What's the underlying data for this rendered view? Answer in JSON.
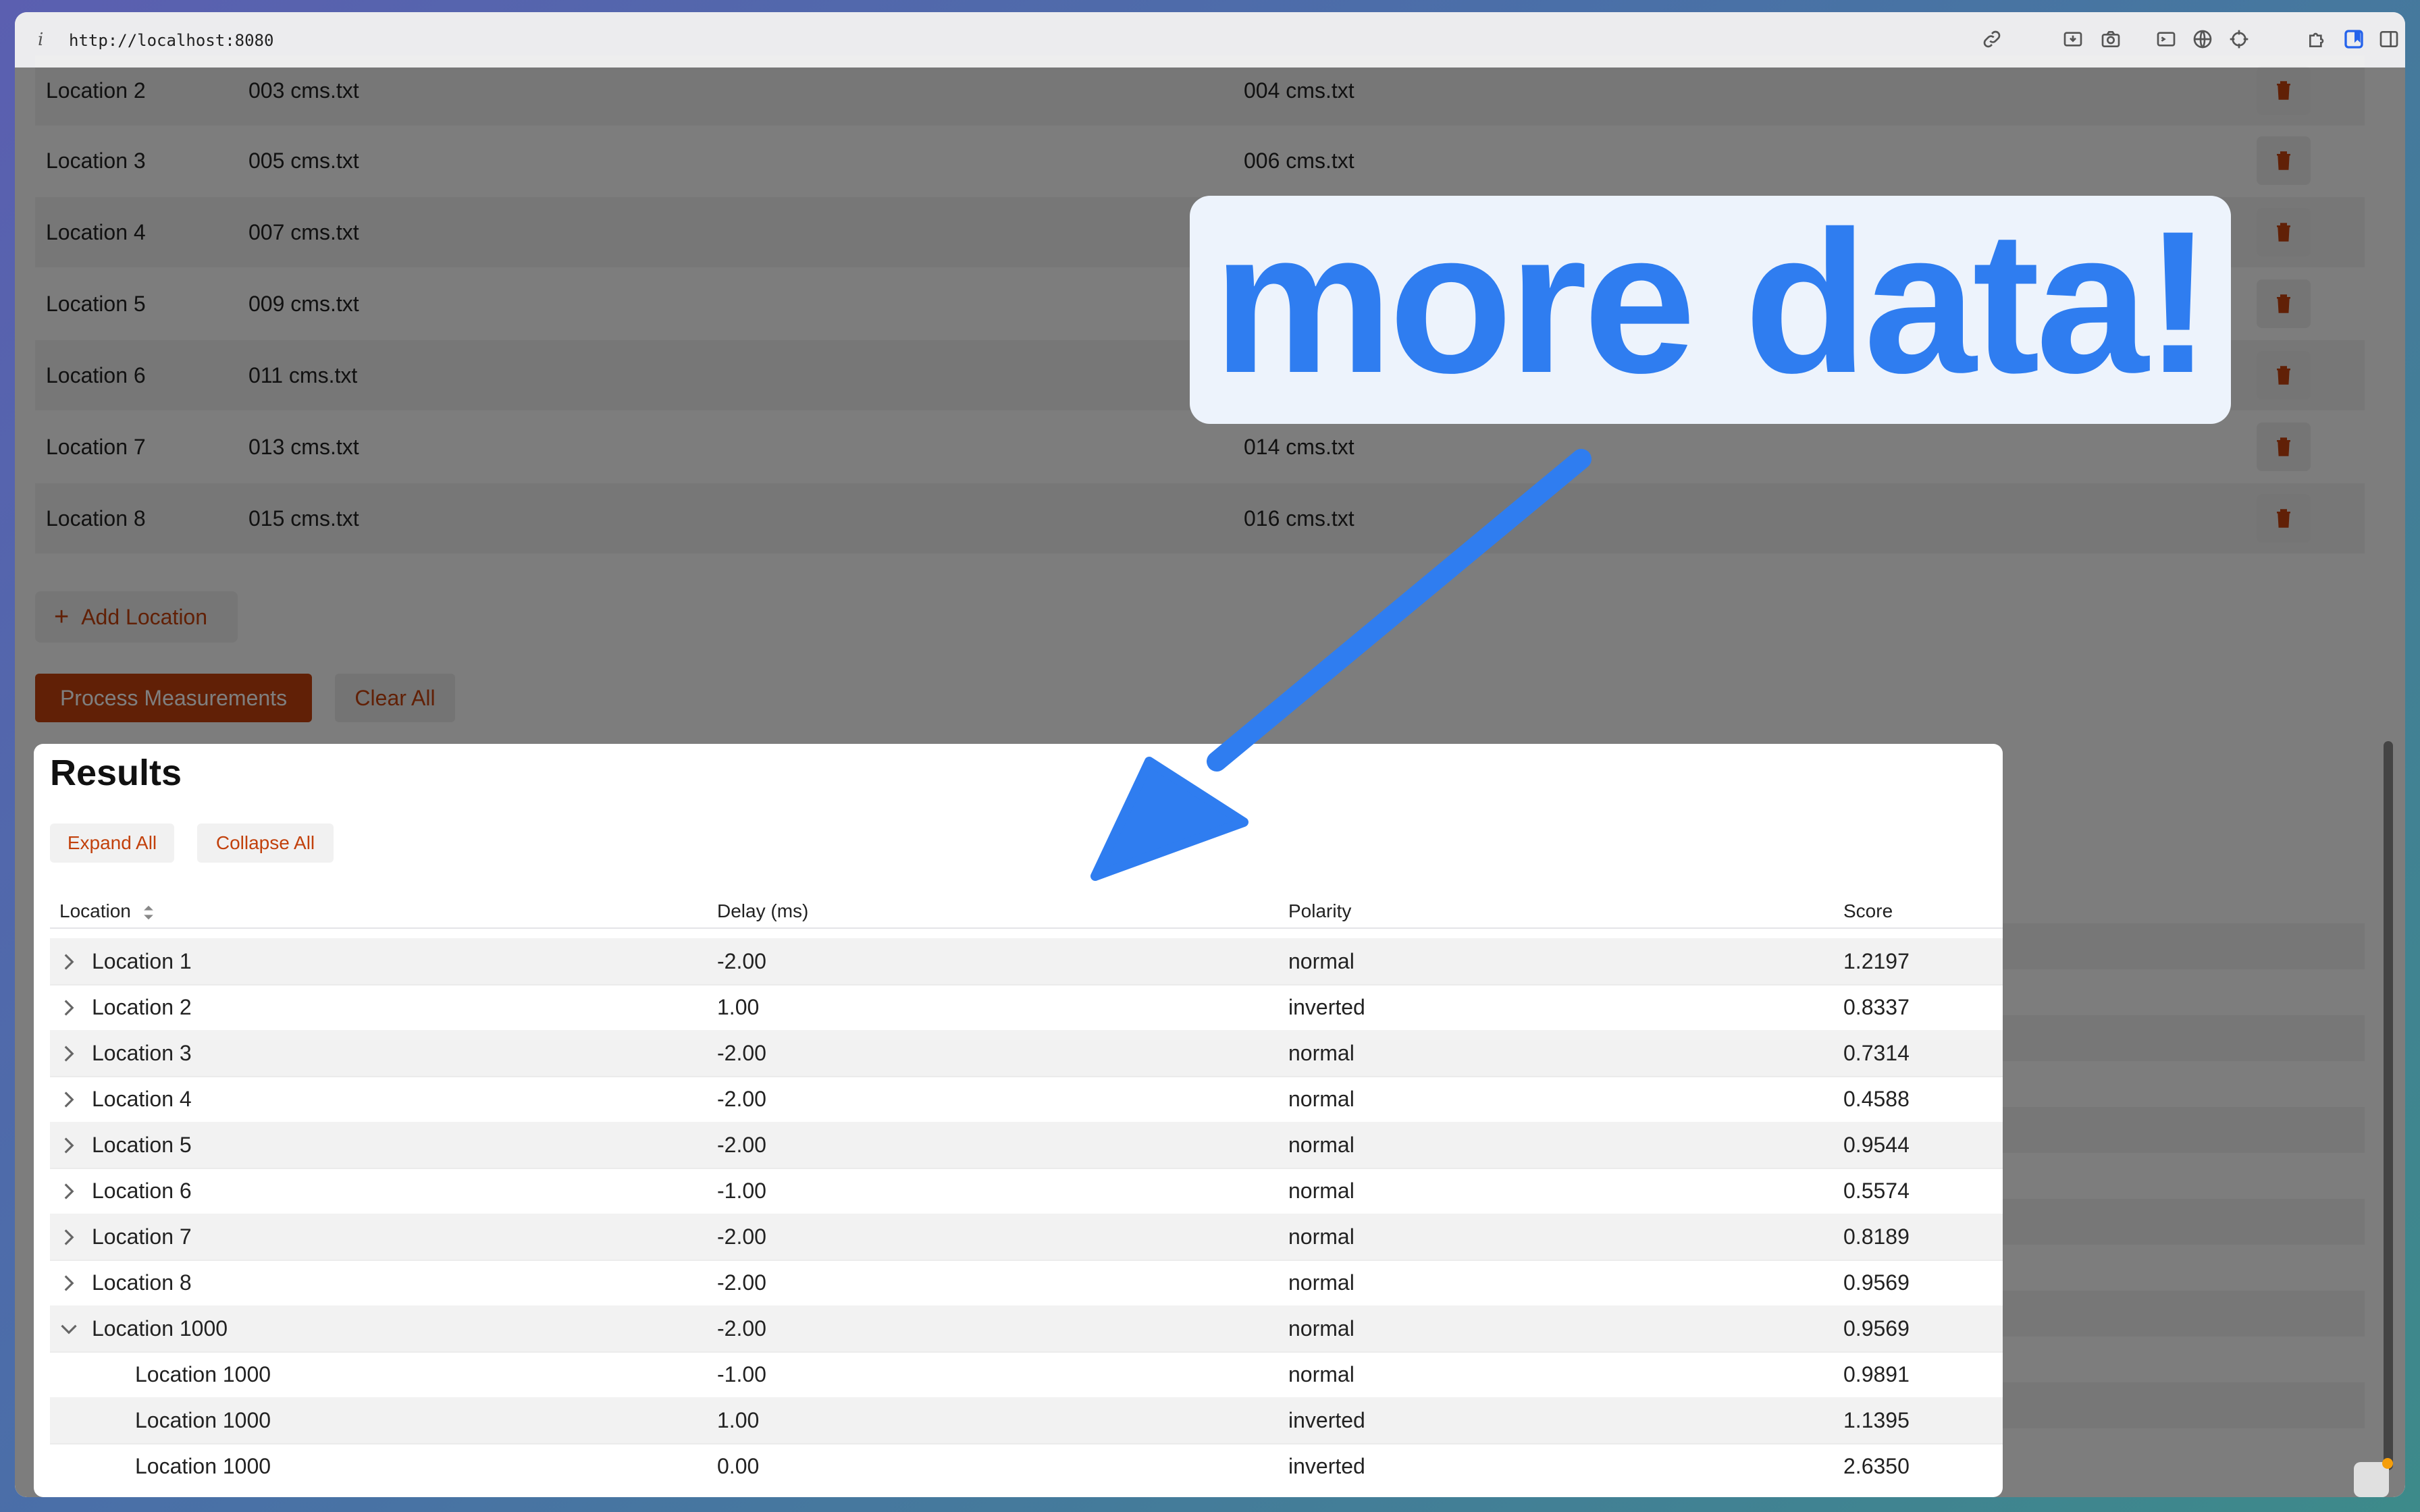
{
  "browser": {
    "url": "http://localhost:8080",
    "info_glyph": "i",
    "icons": [
      "link-icon",
      "download-icon",
      "camera-icon",
      "terminal-icon",
      "globe-icon",
      "crosshair-icon",
      "puzzle-icon",
      "bookmark-icon",
      "sidebar-icon"
    ]
  },
  "locations": [
    {
      "name": "Location 2",
      "file_a": "003 cms.txt",
      "file_b": "004 cms.txt"
    },
    {
      "name": "Location 3",
      "file_a": "005 cms.txt",
      "file_b": "006 cms.txt"
    },
    {
      "name": "Location 4",
      "file_a": "007 cms.txt",
      "file_b": ""
    },
    {
      "name": "Location 5",
      "file_a": "009 cms.txt",
      "file_b": ""
    },
    {
      "name": "Location 6",
      "file_a": "011 cms.txt",
      "file_b": ""
    },
    {
      "name": "Location 7",
      "file_a": "013 cms.txt",
      "file_b": "014 cms.txt"
    },
    {
      "name": "Location 8",
      "file_a": "015 cms.txt",
      "file_b": "016 cms.txt"
    }
  ],
  "buttons": {
    "add_location": "Add Location",
    "add_icon": "+",
    "process": "Process Measurements",
    "clear_all": "Clear All"
  },
  "results": {
    "title": "Results",
    "expand_all": "Expand All",
    "collapse_all": "Collapse All",
    "columns": [
      "Location",
      "Delay (ms)",
      "Polarity",
      "Score"
    ],
    "rows": [
      {
        "location": "Location 1",
        "delay": "-2.00",
        "polarity": "normal",
        "score": "1.2197",
        "state": "collapsed"
      },
      {
        "location": "Location 2",
        "delay": "1.00",
        "polarity": "inverted",
        "score": "0.8337",
        "state": "collapsed"
      },
      {
        "location": "Location 3",
        "delay": "-2.00",
        "polarity": "normal",
        "score": "0.7314",
        "state": "collapsed"
      },
      {
        "location": "Location 4",
        "delay": "-2.00",
        "polarity": "normal",
        "score": "0.4588",
        "state": "collapsed"
      },
      {
        "location": "Location 5",
        "delay": "-2.00",
        "polarity": "normal",
        "score": "0.9544",
        "state": "collapsed"
      },
      {
        "location": "Location 6",
        "delay": "-1.00",
        "polarity": "normal",
        "score": "0.5574",
        "state": "collapsed"
      },
      {
        "location": "Location 7",
        "delay": "-2.00",
        "polarity": "normal",
        "score": "0.8189",
        "state": "collapsed"
      },
      {
        "location": "Location 8",
        "delay": "-2.00",
        "polarity": "normal",
        "score": "0.9569",
        "state": "collapsed"
      },
      {
        "location": "Location 1000",
        "delay": "-2.00",
        "polarity": "normal",
        "score": "0.9569",
        "state": "expanded"
      },
      {
        "location": "Location 1000",
        "delay": "-1.00",
        "polarity": "normal",
        "score": "0.9891",
        "state": "child"
      },
      {
        "location": "Location 1000",
        "delay": "1.00",
        "polarity": "inverted",
        "score": "1.1395",
        "state": "child"
      },
      {
        "location": "Location 1000",
        "delay": "0.00",
        "polarity": "inverted",
        "score": "2.6350",
        "state": "child"
      }
    ]
  },
  "callout": {
    "text": "more data!",
    "color": "#2f7df0"
  },
  "colors": {
    "accent": "#c2410c",
    "callout_bg": "#edf3fc"
  }
}
